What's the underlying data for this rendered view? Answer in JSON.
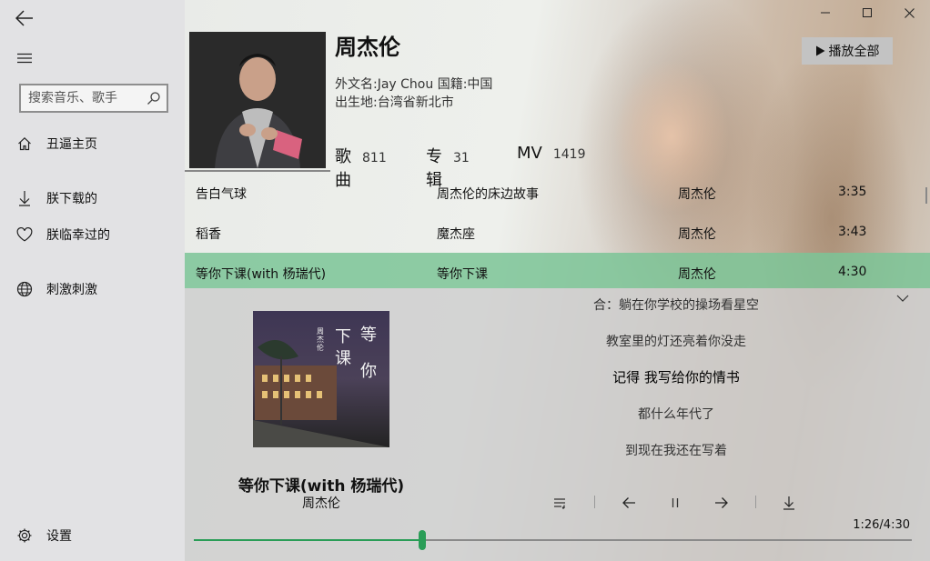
{
  "sidebar": {
    "search_placeholder": "搜索音乐、歌手",
    "items": [
      {
        "label": "丑逼主页",
        "icon": "home-icon"
      },
      {
        "label": "朕下载的",
        "icon": "download-icon"
      },
      {
        "label": "朕临幸过的",
        "icon": "heart-icon"
      },
      {
        "label": "刺激刺激",
        "icon": "globe-icon"
      }
    ],
    "settings_label": "设置"
  },
  "artist": {
    "name": "周杰伦",
    "foreign_name": "外文名:Jay Chou 国籍:中国",
    "birthplace": "出生地:台湾省新北市",
    "play_all_label": "播放全部",
    "stats": {
      "songs_label": "歌曲",
      "songs_count": "811",
      "albums_label": "专辑",
      "albums_count": "31",
      "mv_label": "MV",
      "mv_count": "1419"
    }
  },
  "songs": [
    {
      "title": "告白气球",
      "album": "周杰伦的床边故事",
      "artist": "周杰伦",
      "duration": "3:35"
    },
    {
      "title": "稻香",
      "album": "魔杰座",
      "artist": "周杰伦",
      "duration": "3:43"
    },
    {
      "title": "等你下课(with 杨瑞代)",
      "album": "等你下课",
      "artist": "周杰伦",
      "duration": "4:30"
    }
  ],
  "player": {
    "cover_text": {
      "artist_vertical": "周杰伦",
      "title_char_1": "下",
      "title_char_2": "课",
      "title_char_3": "等",
      "title_char_4": "你"
    },
    "title": "等你下课(with 杨瑞代)",
    "artist": "周杰伦",
    "lyrics": [
      "合：躺在你学校的操场看星空",
      "教室里的灯还亮着你没走",
      "记得 我写给你的情书",
      "都什么年代了",
      "到现在我还在写着"
    ],
    "current_lyric_index": 2,
    "time": "1:26/4:30",
    "progress": 0.318
  },
  "colors": {
    "accent": "#2a9d57",
    "selected_row": "#7bc496"
  }
}
